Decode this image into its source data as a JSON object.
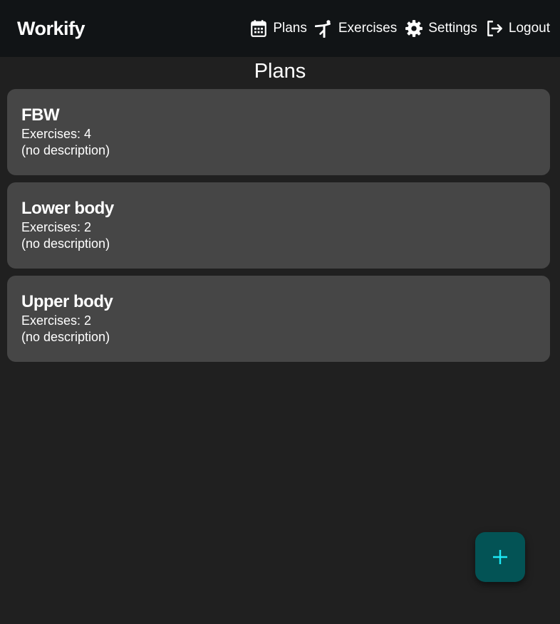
{
  "app": {
    "brand": "Workify"
  },
  "nav": {
    "items": [
      {
        "label": "Plans",
        "icon": "calendar-icon"
      },
      {
        "label": "Exercises",
        "icon": "exercise-figure-icon"
      },
      {
        "label": "Settings",
        "icon": "gear-icon"
      },
      {
        "label": "Logout",
        "icon": "logout-icon"
      }
    ]
  },
  "page": {
    "title": "Plans"
  },
  "plans": [
    {
      "name": "FBW",
      "exercises": "Exercises: 4",
      "description": "(no description)"
    },
    {
      "name": "Lower body",
      "exercises": "Exercises: 2",
      "description": "(no description)"
    },
    {
      "name": "Upper body",
      "exercises": "Exercises: 2",
      "description": "(no description)"
    }
  ],
  "fab": {
    "icon": "plus-icon"
  },
  "colors": {
    "topbar": "#111416",
    "background": "#202020",
    "card": "#464646",
    "fab_bg": "#035355",
    "fab_icon": "#1de9f6",
    "text": "#ffffff"
  }
}
